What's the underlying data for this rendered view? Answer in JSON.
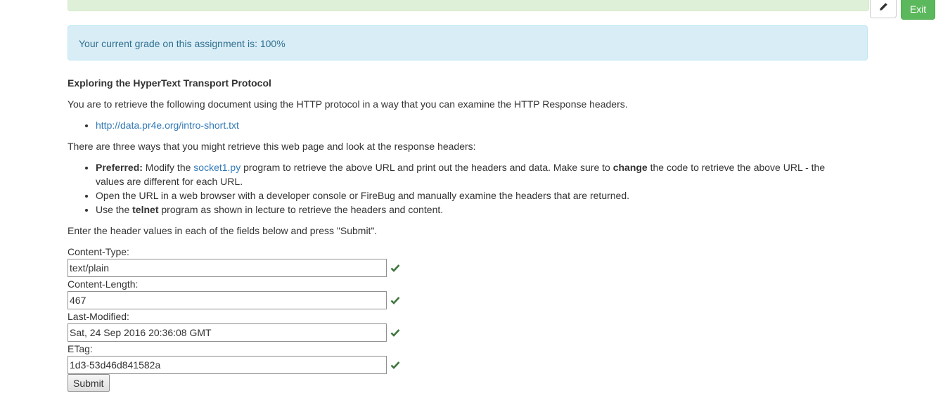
{
  "header": {
    "exit_label": "Exit"
  },
  "grade_alert": "Your current grade on this assignment is: 100%",
  "assignment": {
    "title": "Exploring the HyperText Transport Protocol",
    "intro": "You are to retrieve the following document using the HTTP protocol in a way that you can examine the HTTP Response headers.",
    "url": "http://data.pr4e.org/intro-short.txt",
    "three_ways": "There are three ways that you might retrieve this web page and look at the response headers:",
    "ways": {
      "w1_bold": "Preferred:",
      "w1_a": " Modify the ",
      "w1_link": "socket1.py",
      "w1_b": " program to retrieve the above URL and print out the headers and data. Make sure to ",
      "w1_bold2": "change",
      "w1_c": " the code to retrieve the above URL - the values are different for each URL.",
      "w2": "Open the URL in a web browser with a developer console or FireBug and manually examine the headers that are returned.",
      "w3_a": "Use the ",
      "w3_bold": "telnet",
      "w3_b": " program as shown in lecture to retrieve the headers and content."
    },
    "enter_text": "Enter the header values in each of the fields below and press \"Submit\"."
  },
  "form": {
    "fields": [
      {
        "label": "Content-Type:",
        "value": "text/plain"
      },
      {
        "label": "Content-Length:",
        "value": "467"
      },
      {
        "label": "Last-Modified:",
        "value": "Sat, 24 Sep 2016 20:36:08 GMT"
      },
      {
        "label": "ETag:",
        "value": "1d3-53d46d841582a"
      }
    ],
    "submit_label": "Submit"
  },
  "colors": {
    "check": "#3c763d",
    "link": "#337ab7",
    "exit_bg": "#5cb85c"
  },
  "icons": {
    "edit": "pencil-icon",
    "valid": "checkmark-icon"
  }
}
